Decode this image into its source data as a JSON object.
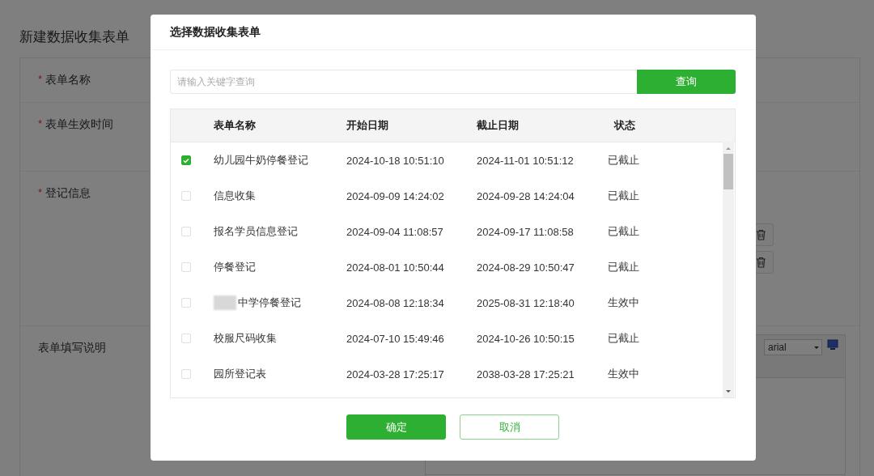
{
  "page": {
    "title": "新建数据收集表单",
    "fields": [
      {
        "label": "表单名称",
        "marker": "*"
      },
      {
        "label": "表单生效时间",
        "marker": "*"
      },
      {
        "label": "登记信息",
        "marker": "*"
      },
      {
        "label": "表单填写说明"
      }
    ],
    "font_select": {
      "value": "arial"
    }
  },
  "dialog": {
    "title": "选择数据收集表单",
    "search": {
      "placeholder": "请输入关键字查询",
      "button": "查询"
    },
    "table": {
      "columns": [
        "表单名称",
        "开始日期",
        "截止日期",
        "状态"
      ],
      "rows": [
        {
          "checked": true,
          "redacted": false,
          "name": "幼儿园牛奶停餐登记",
          "start": "2024-10-18 10:51:10",
          "end": "2024-11-01 10:51:12",
          "status": "已截止"
        },
        {
          "checked": false,
          "redacted": false,
          "name": "信息收集",
          "start": "2024-09-09 14:24:02",
          "end": "2024-09-28 14:24:04",
          "status": "已截止"
        },
        {
          "checked": false,
          "redacted": false,
          "name": "报名学员信息登记",
          "start": "2024-09-04 11:08:57",
          "end": "2024-09-17 11:08:58",
          "status": "已截止"
        },
        {
          "checked": false,
          "redacted": false,
          "name": "停餐登记",
          "start": "2024-08-01 10:50:44",
          "end": "2024-08-29 10:50:47",
          "status": "已截止"
        },
        {
          "checked": false,
          "redacted": true,
          "name": "中学停餐登记",
          "start": "2024-08-08 12:18:34",
          "end": "2025-08-31 12:18:40",
          "status": "生效中"
        },
        {
          "checked": false,
          "redacted": false,
          "name": "校服尺码收集",
          "start": "2024-07-10 15:49:46",
          "end": "2024-10-26 10:50:15",
          "status": "已截止"
        },
        {
          "checked": false,
          "redacted": false,
          "name": "园所登记表",
          "start": "2024-03-28 17:25:17",
          "end": "2038-03-28 17:25:21",
          "status": "生效中"
        }
      ]
    },
    "buttons": [
      {
        "label": "确定",
        "kind": "primary"
      },
      {
        "label": "取消",
        "kind": "secondary"
      }
    ]
  }
}
